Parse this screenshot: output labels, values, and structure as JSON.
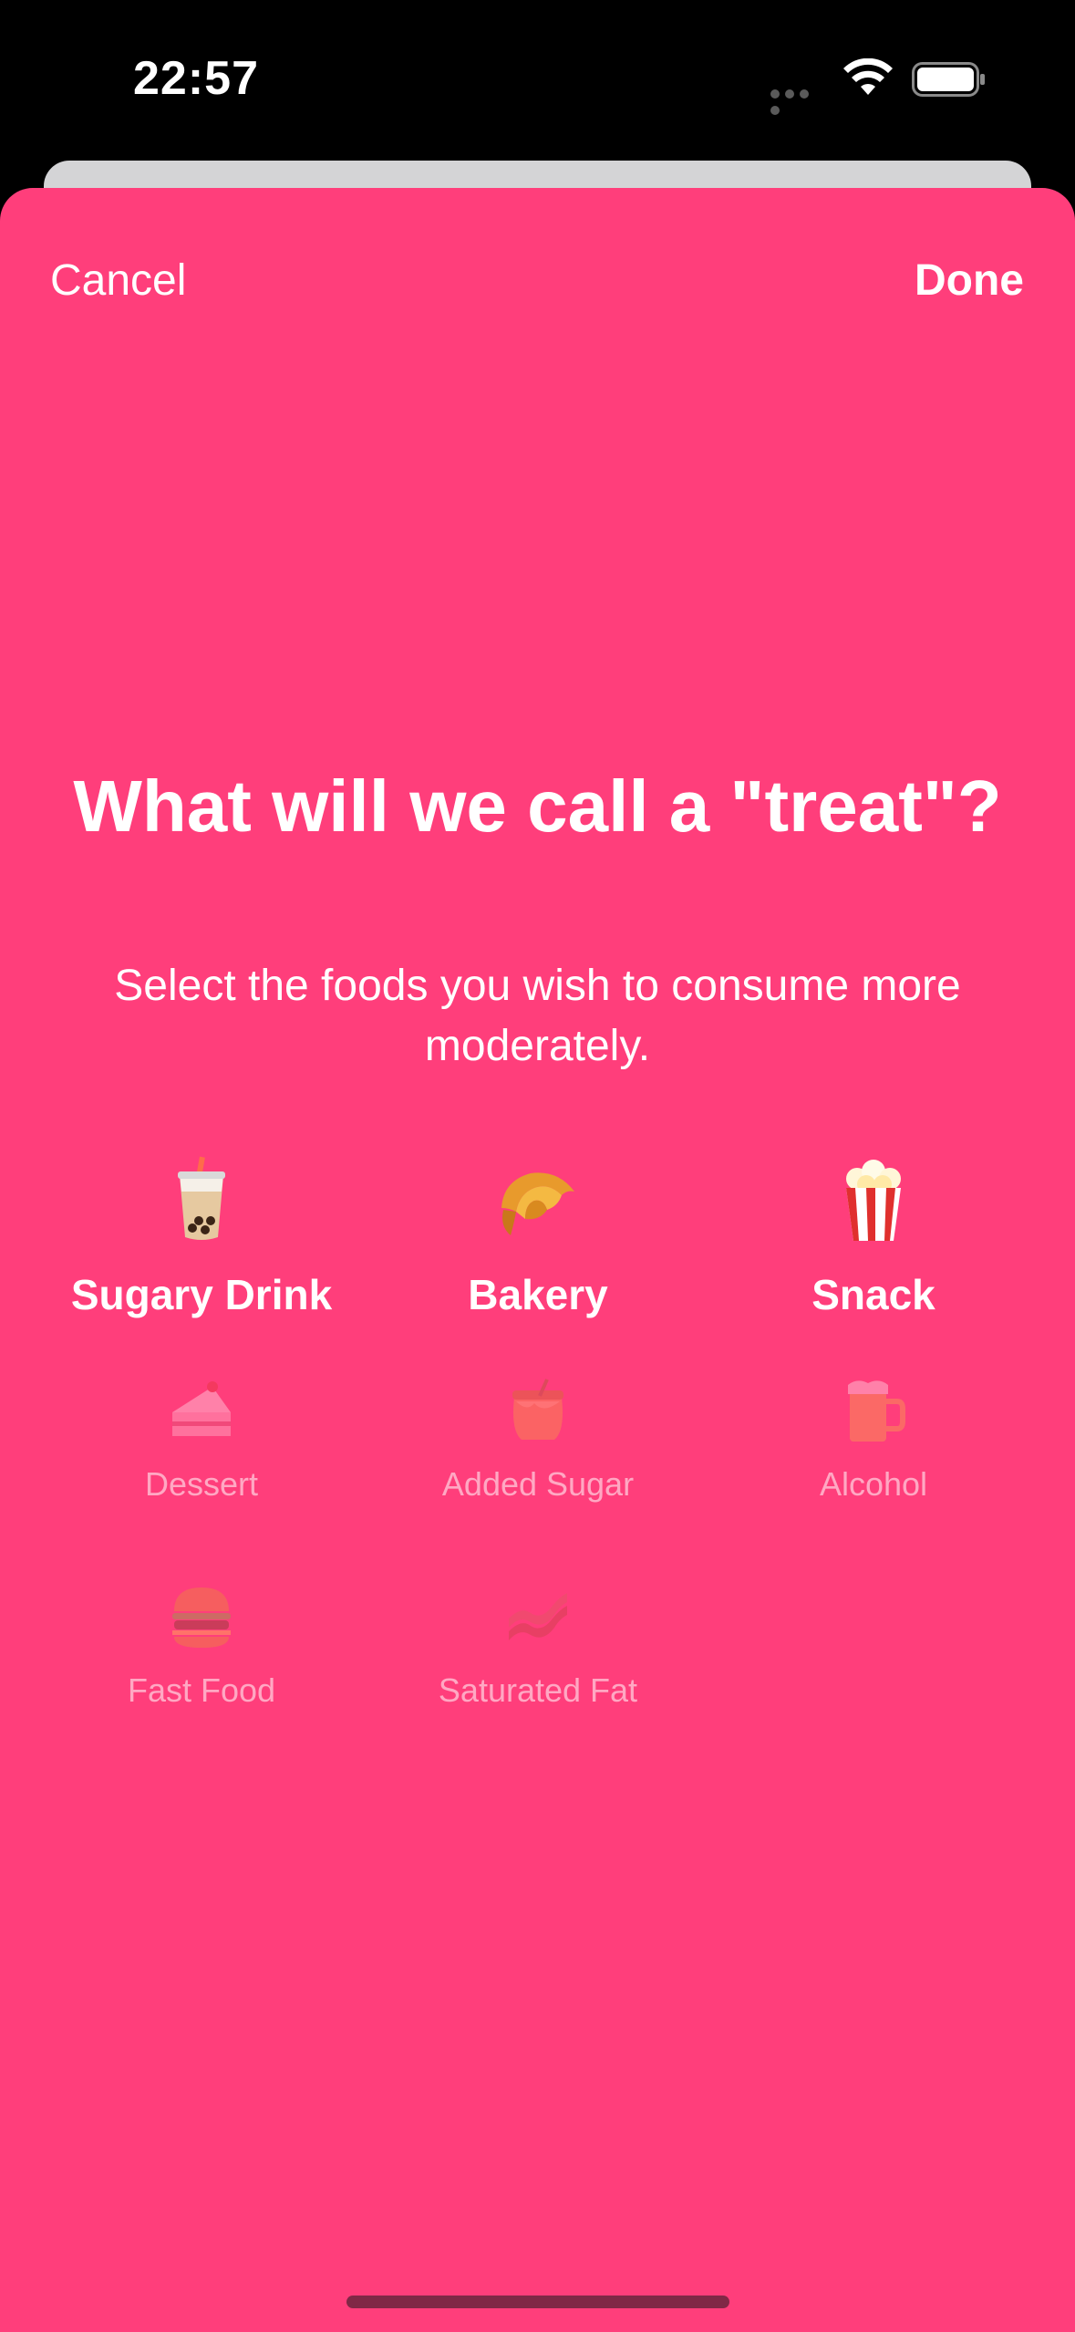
{
  "status_bar": {
    "time": "22:57"
  },
  "nav": {
    "cancel_label": "Cancel",
    "done_label": "Done"
  },
  "content": {
    "title": "What will we call a \"treat\"?",
    "subtitle": "Select the foods you wish to consume more moderately."
  },
  "foods": [
    {
      "label": "Sugary Drink",
      "icon": "bubble-tea-icon",
      "selected": true
    },
    {
      "label": "Bakery",
      "icon": "croissant-icon",
      "selected": true
    },
    {
      "label": "Snack",
      "icon": "popcorn-icon",
      "selected": true
    },
    {
      "label": "Dessert",
      "icon": "cake-slice-icon",
      "selected": false
    },
    {
      "label": "Added Sugar",
      "icon": "honey-pot-icon",
      "selected": false
    },
    {
      "label": "Alcohol",
      "icon": "beer-mug-icon",
      "selected": false
    },
    {
      "label": "Fast Food",
      "icon": "burger-icon",
      "selected": false
    },
    {
      "label": "Saturated Fat",
      "icon": "bacon-icon",
      "selected": false
    }
  ],
  "colors": {
    "accent": "#ff3e7b",
    "status_bar_bg": "#000000",
    "text": "#ffffff"
  }
}
